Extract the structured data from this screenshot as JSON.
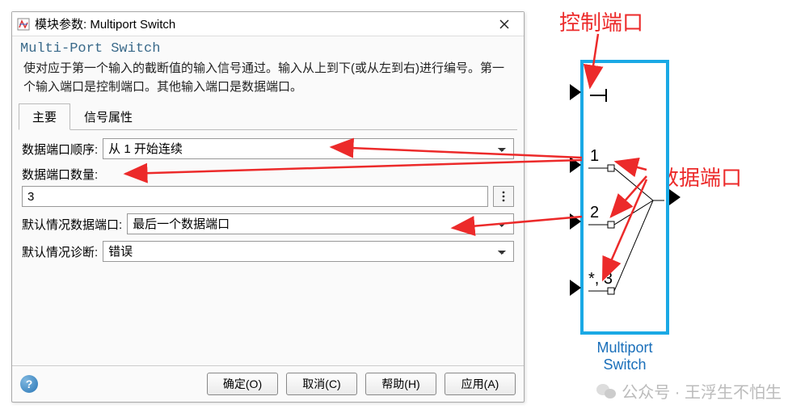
{
  "title": "模块参数: Multiport Switch",
  "group_title": "Multi-Port Switch",
  "description": "使对应于第一个输入的截断值的输入信号通过。输入从上到下(或从左到右)进行编号。第一个输入端口是控制端口。其他输入端口是数据端口。",
  "tabs": {
    "main": "主要",
    "signal": "信号属性"
  },
  "params": {
    "order_label": "数据端口顺序:",
    "order_value": "从 1 开始连续",
    "count_label": "数据端口数量:",
    "count_value": "3",
    "default_port_label": "默认情况数据端口:",
    "default_port_value": "最后一个数据端口",
    "diag_label": "默认情况诊断:",
    "diag_value": "错误"
  },
  "buttons": {
    "ok": "确定(O)",
    "cancel": "取消(C)",
    "help": "帮助(H)",
    "apply": "应用(A)"
  },
  "annotations": {
    "control_port": "控制端口",
    "data_port": "数据端口"
  },
  "block": {
    "label_line1": "Multiport",
    "label_line2": "Switch",
    "port1": "1",
    "port2": "2",
    "port3": "*, 3"
  },
  "watermark": "公众号 · 王浮生不怕生"
}
